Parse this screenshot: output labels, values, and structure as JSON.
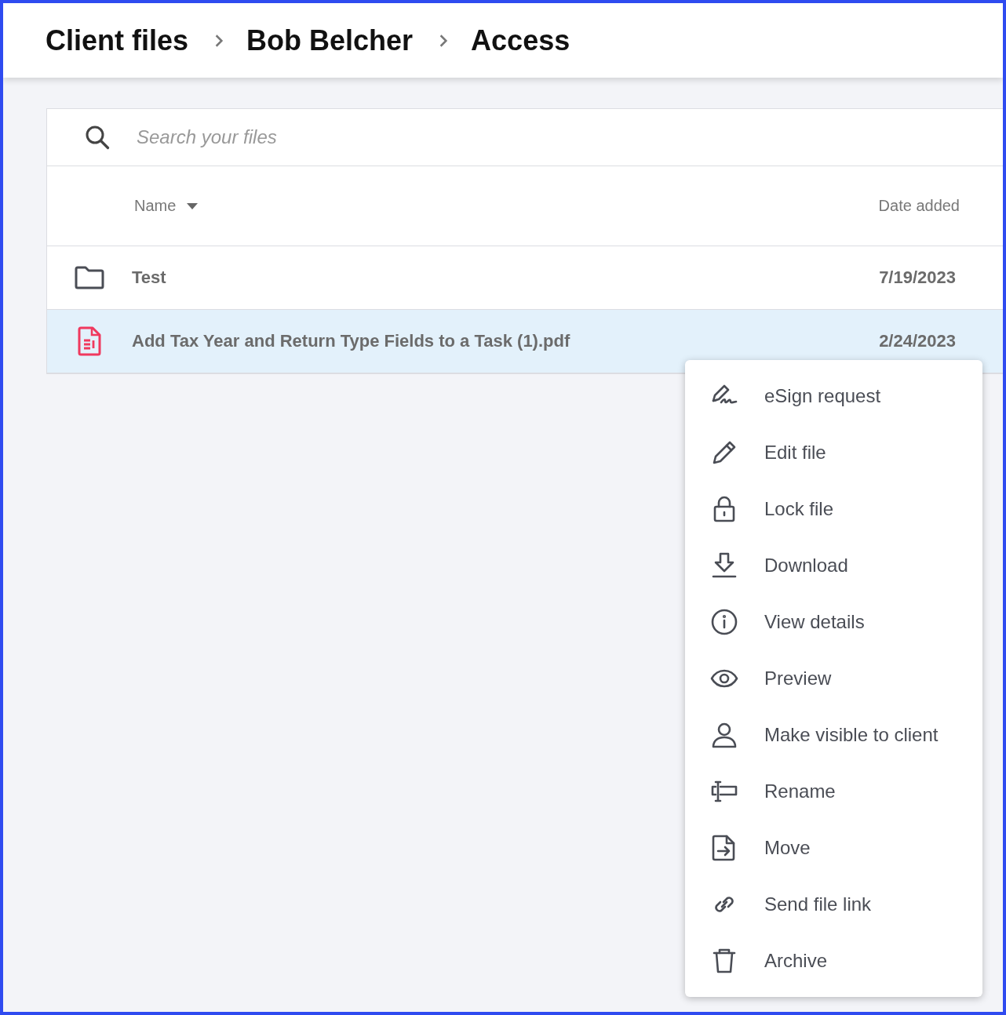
{
  "breadcrumbs": [
    "Client files",
    "Bob Belcher",
    "Access"
  ],
  "search": {
    "placeholder": "Search your files"
  },
  "table": {
    "columns": [
      {
        "label": "Name",
        "sorted": true
      },
      {
        "label": "Date added",
        "sorted": false
      }
    ],
    "rows": [
      {
        "kind": "folder",
        "name": "Test",
        "date": "7/19/2023",
        "selected": false
      },
      {
        "kind": "pdf",
        "name": "Add Tax Year and Return Type Fields to a Task (1).pdf",
        "date": "2/24/2023",
        "selected": true
      }
    ]
  },
  "context_menu": {
    "items": [
      "eSign request",
      "Edit file",
      "Lock file",
      "Download",
      "View details",
      "Preview",
      "Make visible to client",
      "Rename",
      "Move",
      "Send file link",
      "Archive"
    ]
  }
}
